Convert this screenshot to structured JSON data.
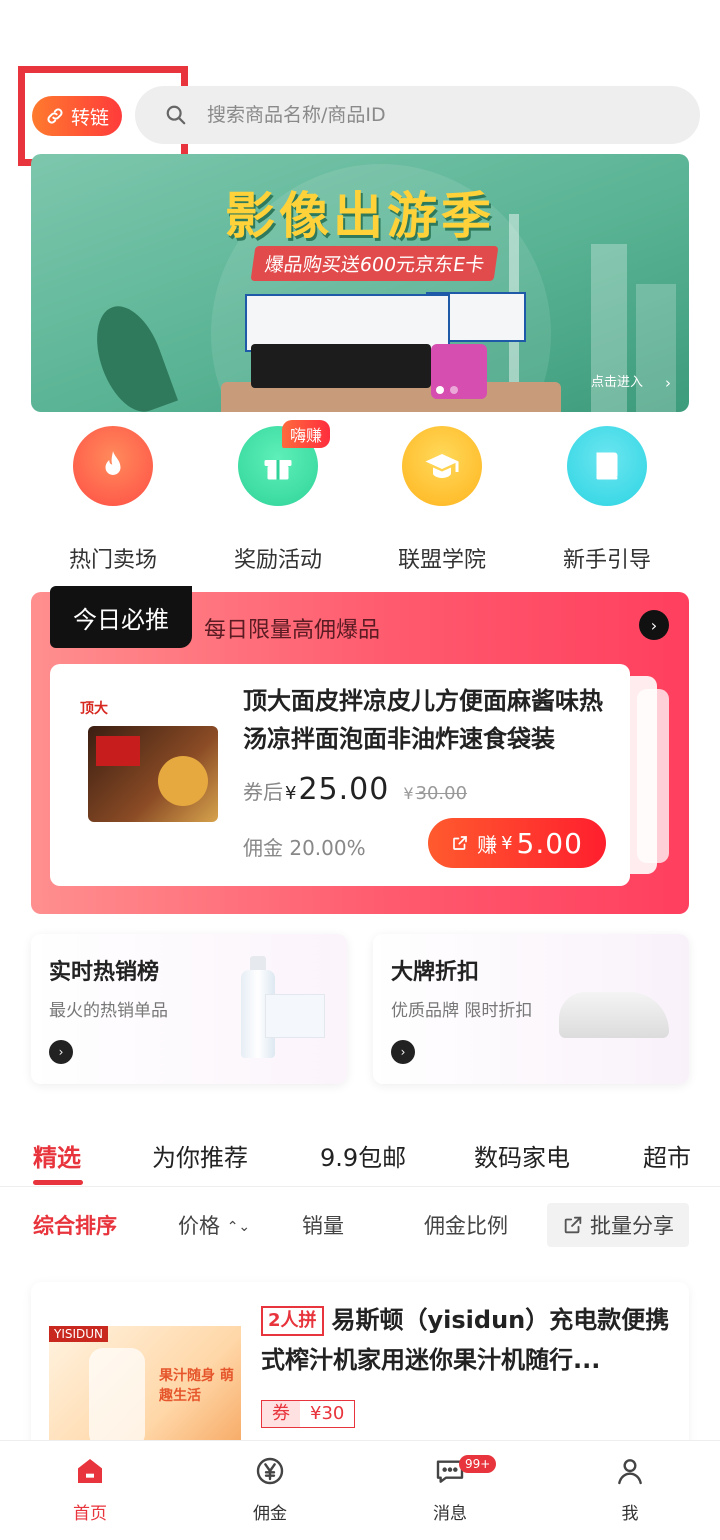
{
  "search": {
    "link_button_label": "转链",
    "placeholder": "搜索商品名称/商品ID"
  },
  "banner": {
    "title": "影像出游季",
    "subtitle": "爆品购买送600元京东E卡",
    "enter_label": "点击进入"
  },
  "quick_nav": [
    {
      "label": "热门卖场",
      "icon": "flame-icon",
      "color": "#ff4e45"
    },
    {
      "label": "奖励活动",
      "icon": "gift-icon",
      "color": "#2fd39a",
      "badge": "嗨赚"
    },
    {
      "label": "联盟学院",
      "icon": "graduation-cap-icon",
      "color": "#ffbe1e"
    },
    {
      "label": "新手引导",
      "icon": "book-icon",
      "color": "#2dd4e3"
    }
  ],
  "today": {
    "tag": "今日必推",
    "subtitle": "每日限量高佣爆品",
    "product": {
      "brand": "顶大",
      "title": "顶大面皮拌凉皮儿方便面麻酱味热汤凉拌面泡面非油炸速食袋装",
      "price_prefix": "券后",
      "currency": "¥",
      "price": "25.00",
      "original_price": "30.00",
      "commission": "佣金 20.00%",
      "earn_label": "赚",
      "earn_value": "5.00"
    }
  },
  "promos": [
    {
      "title": "实时热销榜",
      "subtitle": "最火的热销单品"
    },
    {
      "title": "大牌折扣",
      "subtitle": "优质品牌 限时折扣"
    }
  ],
  "categories": [
    "精选",
    "为你推荐",
    "9.9包邮",
    "数码家电",
    "超市"
  ],
  "sort": {
    "options": [
      "综合排序",
      "价格",
      "销量",
      "佣金比例"
    ],
    "batch_share": "批量分享"
  },
  "list_item": {
    "group_tag": "2人拼",
    "title": "易斯顿（yisidun）充电款便携式榨汁机家用迷你果汁机随行...",
    "coupon_label": "券",
    "coupon_value": "¥30",
    "image_brand": "YISIDUN",
    "image_text": "果汁随身 萌趣生活"
  },
  "bottom_nav": [
    {
      "label": "首页",
      "icon": "home-icon",
      "active": true
    },
    {
      "label": "佣金",
      "icon": "yen-icon"
    },
    {
      "label": "消息",
      "icon": "message-icon",
      "badge": "99+"
    },
    {
      "label": "我",
      "icon": "user-icon"
    }
  ],
  "colors": {
    "accent": "#e8343c",
    "search_bg": "#eeeeee",
    "today_gradient_end": "#ff3f5e"
  }
}
